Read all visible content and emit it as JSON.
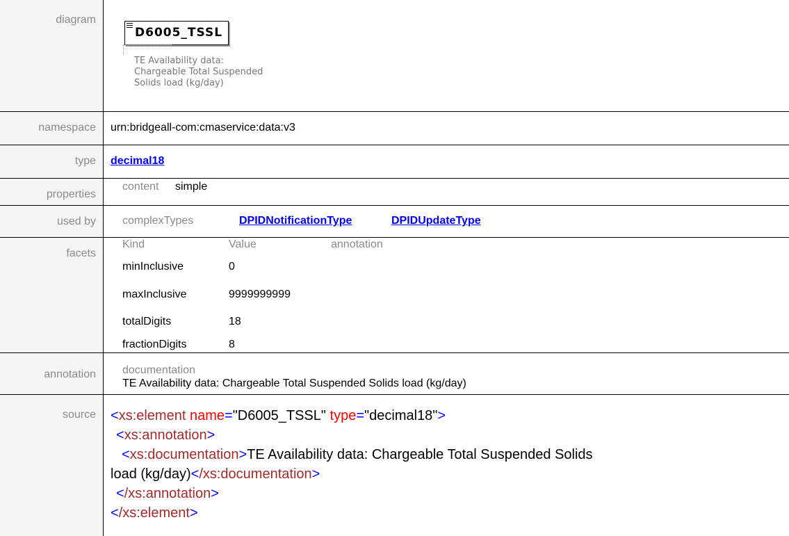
{
  "labels": {
    "diagram": "diagram",
    "namespace": "namespace",
    "type": "type",
    "properties": "properties",
    "used_by": "used by",
    "facets": "facets",
    "annotation": "annotation",
    "source": "source"
  },
  "diagram": {
    "element_name": "D6005_TSSL",
    "doc_lines": [
      "TE Availability data:",
      "Chargeable Total Suspended",
      "Solids load (kg/day)"
    ]
  },
  "namespace": "urn:bridgeall-com:cmaservice:data:v3",
  "type": "decimal18",
  "properties": {
    "key": "content",
    "value": "simple"
  },
  "used_by": {
    "key": "complexTypes",
    "links": [
      "DPIDNotificationType",
      "DPIDUpdateType"
    ]
  },
  "facets": {
    "headers": [
      "Kind",
      "Value",
      "annotation"
    ],
    "rows": [
      {
        "kind": "minInclusive",
        "value": "0"
      },
      {
        "kind": "maxInclusive",
        "value": "9999999999"
      },
      {
        "kind": "totalDigits",
        "value": "18"
      },
      {
        "kind": "fractionDigits",
        "value": "8"
      }
    ]
  },
  "annotation": {
    "key": "documentation",
    "text": "TE Availability data: Chargeable Total Suspended Solids load (kg/day)"
  },
  "source": {
    "line1": {
      "tag": "xs:element",
      "attr1": "name",
      "val1": "\"D6005_TSSL\"",
      "attr2": "type",
      "val2": "\"decimal18\""
    },
    "line2": {
      "tag": "xs:annotation"
    },
    "line3": {
      "tag": "xs:documentation",
      "text_a": "TE Availability data: Chargeable Total Suspended Solids",
      "text_b": "load (kg/day)",
      "close_tag": "/xs:documentation"
    },
    "line4": {
      "close_tag": "/xs:annotation"
    },
    "line5": {
      "close_tag": "/xs:element"
    }
  }
}
